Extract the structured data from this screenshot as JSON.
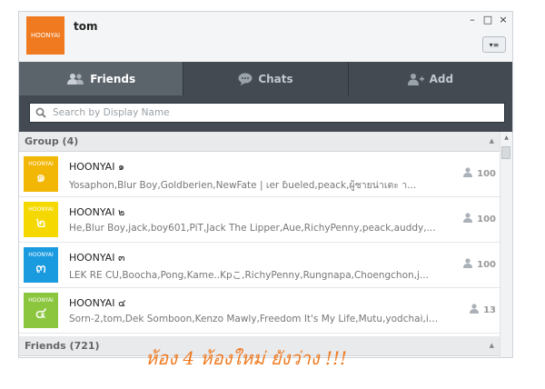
{
  "header": {
    "avatar_text": "HOONYAI",
    "username": "tom",
    "minimize": "–",
    "maximize": "□",
    "close": "×",
    "menu": "▾≡"
  },
  "tabs": [
    {
      "label": "Friends",
      "icon": "friends-icon",
      "active": true
    },
    {
      "label": "Chats",
      "icon": "chat-bubble-icon",
      "active": false
    },
    {
      "label": "Add",
      "icon": "add-friend-icon",
      "active": false
    }
  ],
  "search": {
    "placeholder": "Search by Display Name"
  },
  "groups_section": {
    "label": "Group (4)",
    "arrow": "▲"
  },
  "groups": [
    {
      "avatar_brand": "HOONYAI",
      "avatar_number": "๑",
      "avatar_color": "#f2b705",
      "name": "HOONYAI ๑",
      "members": "Yosaphon,Blur Boy,Goldberien,NewFate | เer ɓueled,peack,ผู้ชายน่าเตะ า...",
      "count": "100"
    },
    {
      "avatar_brand": "HOONYAI",
      "avatar_number": "๒",
      "avatar_color": "#f5d800",
      "name": "HOONYAI ๒",
      "members": "He,Blur Boy,jack,boy601,PiT,Jack The Lipper,Aue,RichyPenny,peack,auddy,...",
      "count": "100"
    },
    {
      "avatar_brand": "HOONYAI",
      "avatar_number": "๓",
      "avatar_color": "#1a9be0",
      "name": "HOONYAI ๓",
      "members": "LEK RE CU,Boocha,Pong,Kame..Kpこ,RichyPenny,Rungnapa,Choengchon,j...",
      "count": "100"
    },
    {
      "avatar_brand": "HOONYAI",
      "avatar_number": "๔",
      "avatar_color": "#8cc63f",
      "name": "HOONYAI ๔",
      "members": "Sorn-2,tom,Dek Somboon,Kenzo Mawly,Freedom It's My Life,Mutu,yodchai,ibe...",
      "count": "13"
    }
  ],
  "friends_section": {
    "label": "Friends (721)",
    "arrow": "▲"
  },
  "scrollbar": {
    "up": "▲",
    "down": "▼"
  },
  "annotation": "ห้อง 4 ห้องใหม่ ยังว่าง !!!",
  "colors": {
    "accent_orange": "#f07a20",
    "tab_bar": "#434a52",
    "tab_active": "#5b636b"
  }
}
